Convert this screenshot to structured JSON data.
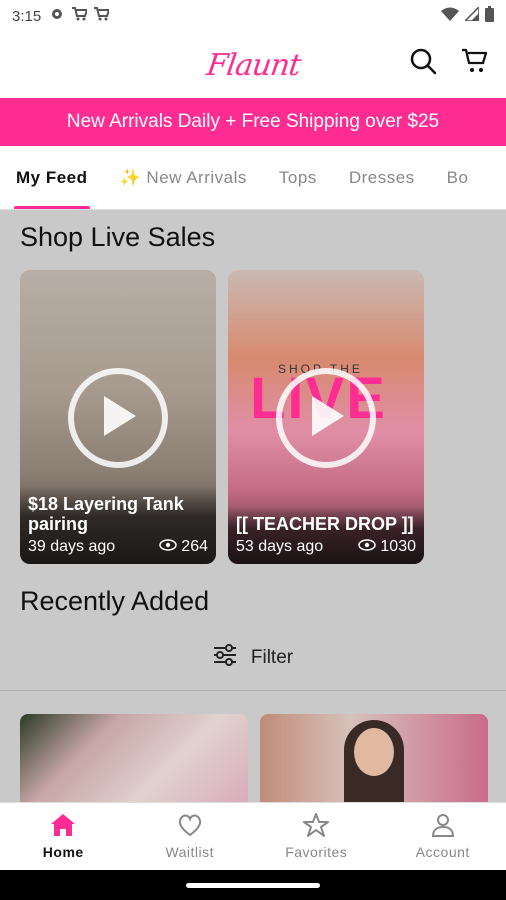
{
  "status_bar": {
    "time": "3:15",
    "icons_left": [
      "gear-icon",
      "cart-icon",
      "cart-icon"
    ],
    "icons_right": [
      "wifi-icon",
      "signal-icon",
      "battery-icon"
    ]
  },
  "header": {
    "logo_text": "Flaunt",
    "actions": [
      "search-icon",
      "cart-icon"
    ]
  },
  "promo": {
    "text": "New Arrivals Daily + Free Shipping over $25"
  },
  "tabs": [
    {
      "label": "My Feed",
      "active": true
    },
    {
      "label": "✨ New Arrivals",
      "active": false
    },
    {
      "label": "Tops",
      "active": false
    },
    {
      "label": "Dresses",
      "active": false
    },
    {
      "label": "Bo",
      "active": false
    }
  ],
  "live_sales": {
    "title": "Shop Live Sales",
    "cards": [
      {
        "title": "$18 Layering Tank pairing",
        "age": "39 days ago",
        "views": "264"
      },
      {
        "title": "[[ TEACHER DROP ]]",
        "age": "53 days ago",
        "views": "1030",
        "art_small": "SHOP THE",
        "art_big": "LIVE"
      }
    ]
  },
  "recently_added": {
    "title": "Recently Added",
    "filter_label": "Filter"
  },
  "bottom_nav": [
    {
      "label": "Home",
      "icon": "home-icon",
      "active": true
    },
    {
      "label": "Waitlist",
      "icon": "heart-icon",
      "active": false
    },
    {
      "label": "Favorites",
      "icon": "star-icon",
      "active": false
    },
    {
      "label": "Account",
      "icon": "account-icon",
      "active": false
    }
  ],
  "colors": {
    "brand": "#ff2d91",
    "overlay_bg": "#c9c9c9"
  }
}
